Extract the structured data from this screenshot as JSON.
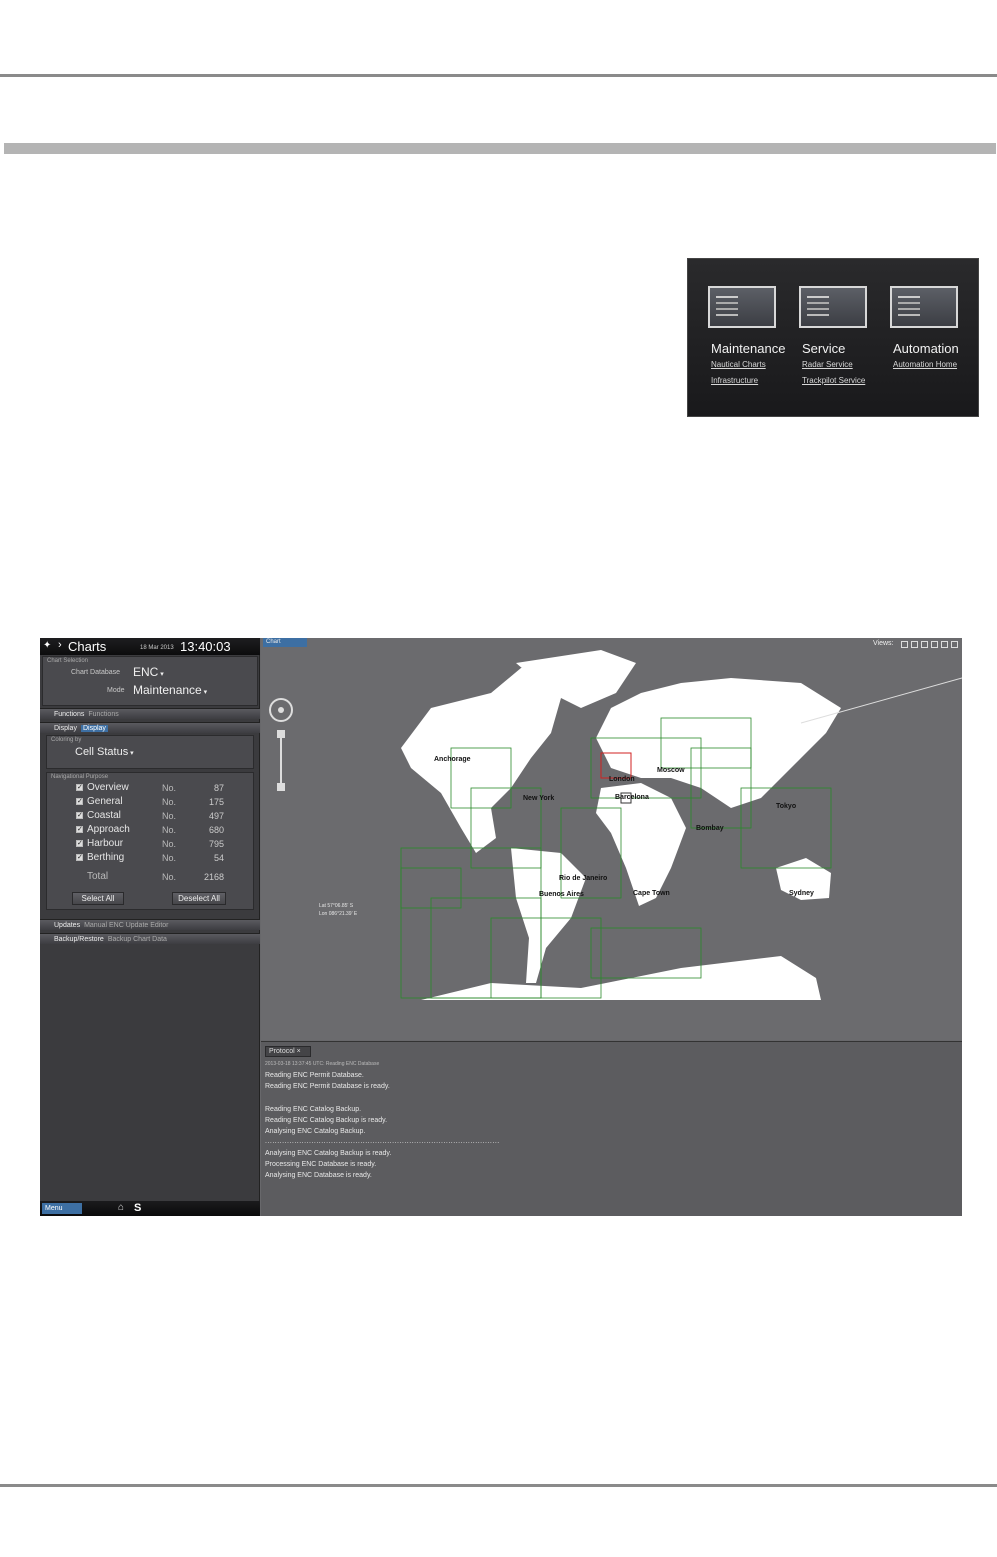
{
  "dashboard": {
    "columns": [
      {
        "title": "Maintenance",
        "links": [
          "Nautical Charts",
          "Infrastructure"
        ]
      },
      {
        "title": "Service",
        "links": [
          "Radar Service",
          "Trackpilot Service"
        ]
      },
      {
        "title": "Automation",
        "links": [
          "Automation Home"
        ]
      }
    ]
  },
  "app": {
    "header": {
      "title": "Charts",
      "date": "18 Mar 2013",
      "time": "13:40:03 UTC"
    },
    "chart_selection": {
      "group_label": "Chart Selection",
      "database_label": "Chart Database",
      "database_value": "ENC",
      "mode_label": "Mode",
      "mode_value": "Maintenance"
    },
    "functions_bar": {
      "label": "Functions",
      "sub": "Functions"
    },
    "display_bar": {
      "label": "Display",
      "sub": "Display"
    },
    "coloring": {
      "label": "Coloring by",
      "value": "Cell Status"
    },
    "navigational_purpose": {
      "label": "Navigational Purpose",
      "rows": [
        {
          "name": "Overview",
          "no": "No.",
          "count": "87"
        },
        {
          "name": "General",
          "no": "No.",
          "count": "175"
        },
        {
          "name": "Coastal",
          "no": "No.",
          "count": "497"
        },
        {
          "name": "Approach",
          "no": "No.",
          "count": "680"
        },
        {
          "name": "Harbour",
          "no": "No.",
          "count": "795"
        },
        {
          "name": "Berthing",
          "no": "No.",
          "count": "54"
        }
      ],
      "total": {
        "name": "Total",
        "no": "No.",
        "count": "2168"
      }
    },
    "buttons": {
      "select_all": "Select All",
      "deselect_all": "Deselect All"
    },
    "updates_bar": {
      "label": "Updates",
      "sub": "Manual ENC Update Editor"
    },
    "backup_bar": {
      "label": "Backup/Restore",
      "sub": "Backup Chart Data"
    },
    "footer": {
      "menu": "Menu",
      "s_label": "S"
    },
    "map": {
      "tab": "Chart",
      "views_label": "Views:",
      "cities": [
        "Anchorage",
        "New York",
        "London",
        "Moscow",
        "Barcelona",
        "Tokyo",
        "Bombay",
        "Rio de Janeiro",
        "Buenos Aires",
        "Cape Town",
        "Sydney"
      ],
      "lat_label": "Lat",
      "lat_value": "57°06.85' S",
      "lon_label": "Lon",
      "lon_value": "086°21.39' E"
    },
    "protocol": {
      "tab": "Protocol",
      "lines": [
        "2013-03-18 13:37:45 UTC: Reading ENC Database",
        "Reading ENC Permit Database.",
        "Reading ENC Permit Database is ready.",
        "",
        "Reading ENC Catalog Backup.",
        "Reading ENC Catalog Backup is ready.",
        "Analysing ENC Catalog Backup.",
        "................................................................................................",
        "Analysing ENC Catalog Backup is ready.",
        "Processing ENC Database is ready.",
        "Analysing ENC Database is ready."
      ]
    }
  }
}
